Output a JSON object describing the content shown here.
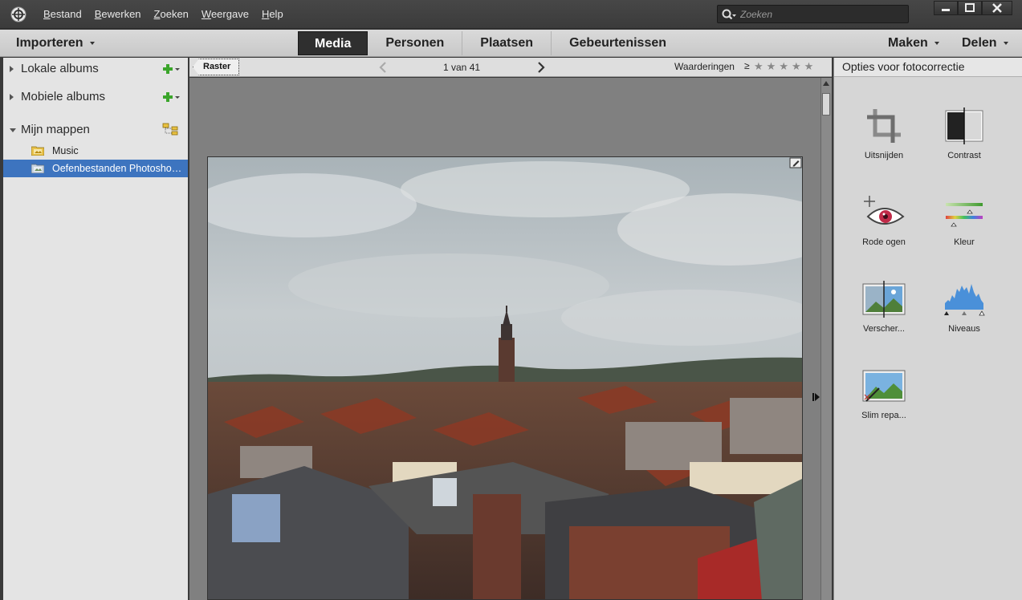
{
  "menubar": {
    "items": [
      "Bestand",
      "Bewerken",
      "Zoeken",
      "Weergave",
      "Help"
    ],
    "search_placeholder": "Zoeken"
  },
  "tabbar": {
    "import_label": "Importeren",
    "tabs": [
      "Media",
      "Personen",
      "Plaatsen",
      "Gebeurtenissen"
    ],
    "active_tab": "Media",
    "create_label": "Maken",
    "share_label": "Delen"
  },
  "left_panel": {
    "local_albums": "Lokale albums",
    "mobile_albums": "Mobiele albums",
    "my_folders": "Mijn mappen",
    "folders": [
      {
        "label": "Music",
        "selected": false
      },
      {
        "label": "Oefenbestanden Photoshop Elements",
        "selected": true
      }
    ]
  },
  "viewer": {
    "grid_button": "Raster",
    "page_count": "1 van 41",
    "ratings_label": "Waarderingen",
    "ratings_operator": "≥",
    "rating_stars": 5
  },
  "right_panel": {
    "title": "Opties voor fotocorrectie",
    "tools": [
      {
        "label": "Uitsnijden",
        "icon": "crop-icon"
      },
      {
        "label": "Contrast",
        "icon": "contrast-icon"
      },
      {
        "label": "Rode ogen",
        "icon": "red-eye-icon"
      },
      {
        "label": "Kleur",
        "icon": "color-icon"
      },
      {
        "label": "Verscher...",
        "icon": "sharpen-icon"
      },
      {
        "label": "Niveaus",
        "icon": "levels-icon"
      },
      {
        "label": "Slim repa...",
        "icon": "smart-fix-icon"
      }
    ]
  },
  "colors": {
    "accent": "#3d74bf",
    "active_tab": "#2f2f2f",
    "add_green": "#3aa52a"
  }
}
